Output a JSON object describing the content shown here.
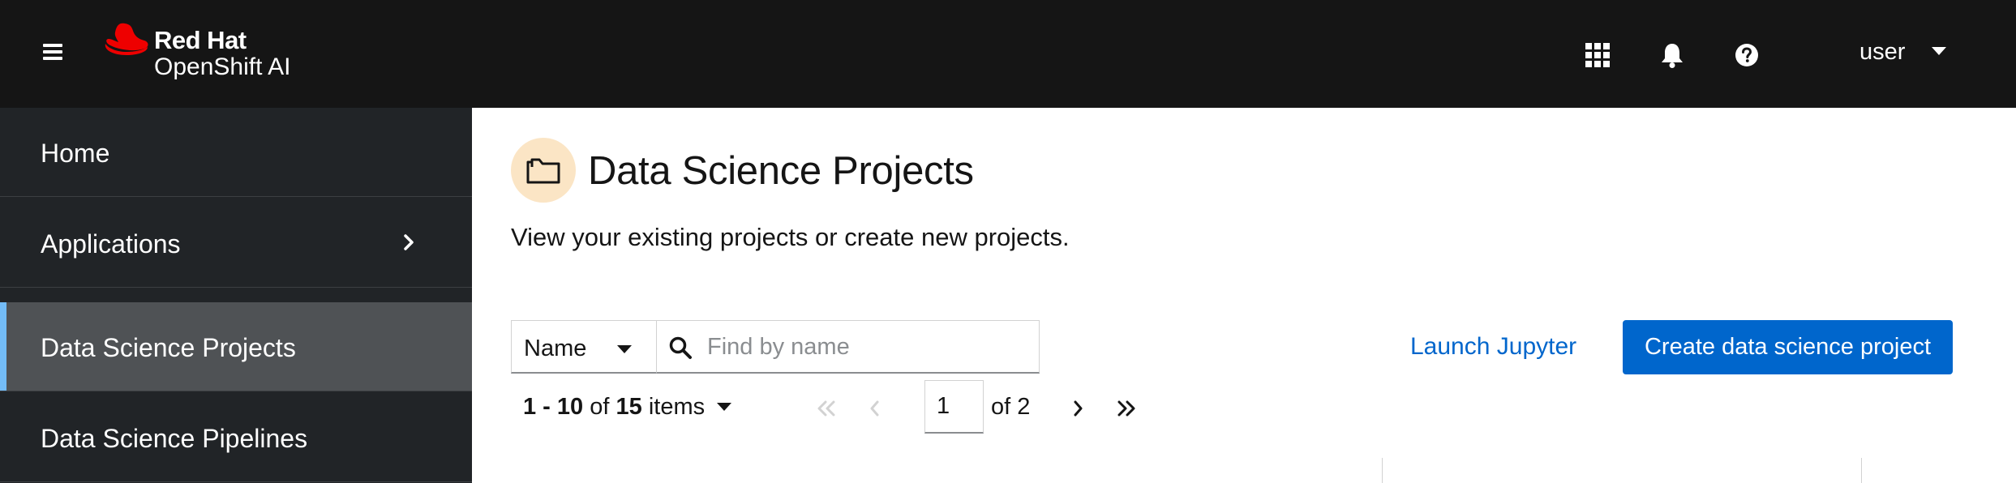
{
  "masthead": {
    "brand_line1": "Red Hat",
    "brand_line2": "OpenShift AI",
    "user_name": "user",
    "icons": [
      "menu-icon",
      "app-launcher-icon",
      "bell-icon",
      "help-icon",
      "caret-down-icon"
    ]
  },
  "sidebar": {
    "items": [
      {
        "label": "Home"
      },
      {
        "label": "Applications"
      },
      {
        "label": "Data Science Projects"
      },
      {
        "label": "Data Science Pipelines"
      }
    ],
    "active_index": 2
  },
  "main": {
    "title": "Data Science Projects",
    "description": "View your existing projects or create new projects.",
    "filter_attribute": "Name",
    "search_placeholder": "Find by name",
    "launch_label": "Launch Jupyter",
    "create_label": "Create data science project"
  },
  "pagination": {
    "range": "1 - 10",
    "of_word": "of",
    "total": "15",
    "items_word": "items",
    "page": "1",
    "of_pages": "of 2"
  },
  "colors": {
    "masthead_bg": "#151515",
    "sidebar_bg": "#212427",
    "active_nav_bg": "#4f5255",
    "active_accent": "#73bcf7",
    "primary": "#0066cc",
    "title_icon_bg": "#fbe5c5"
  }
}
